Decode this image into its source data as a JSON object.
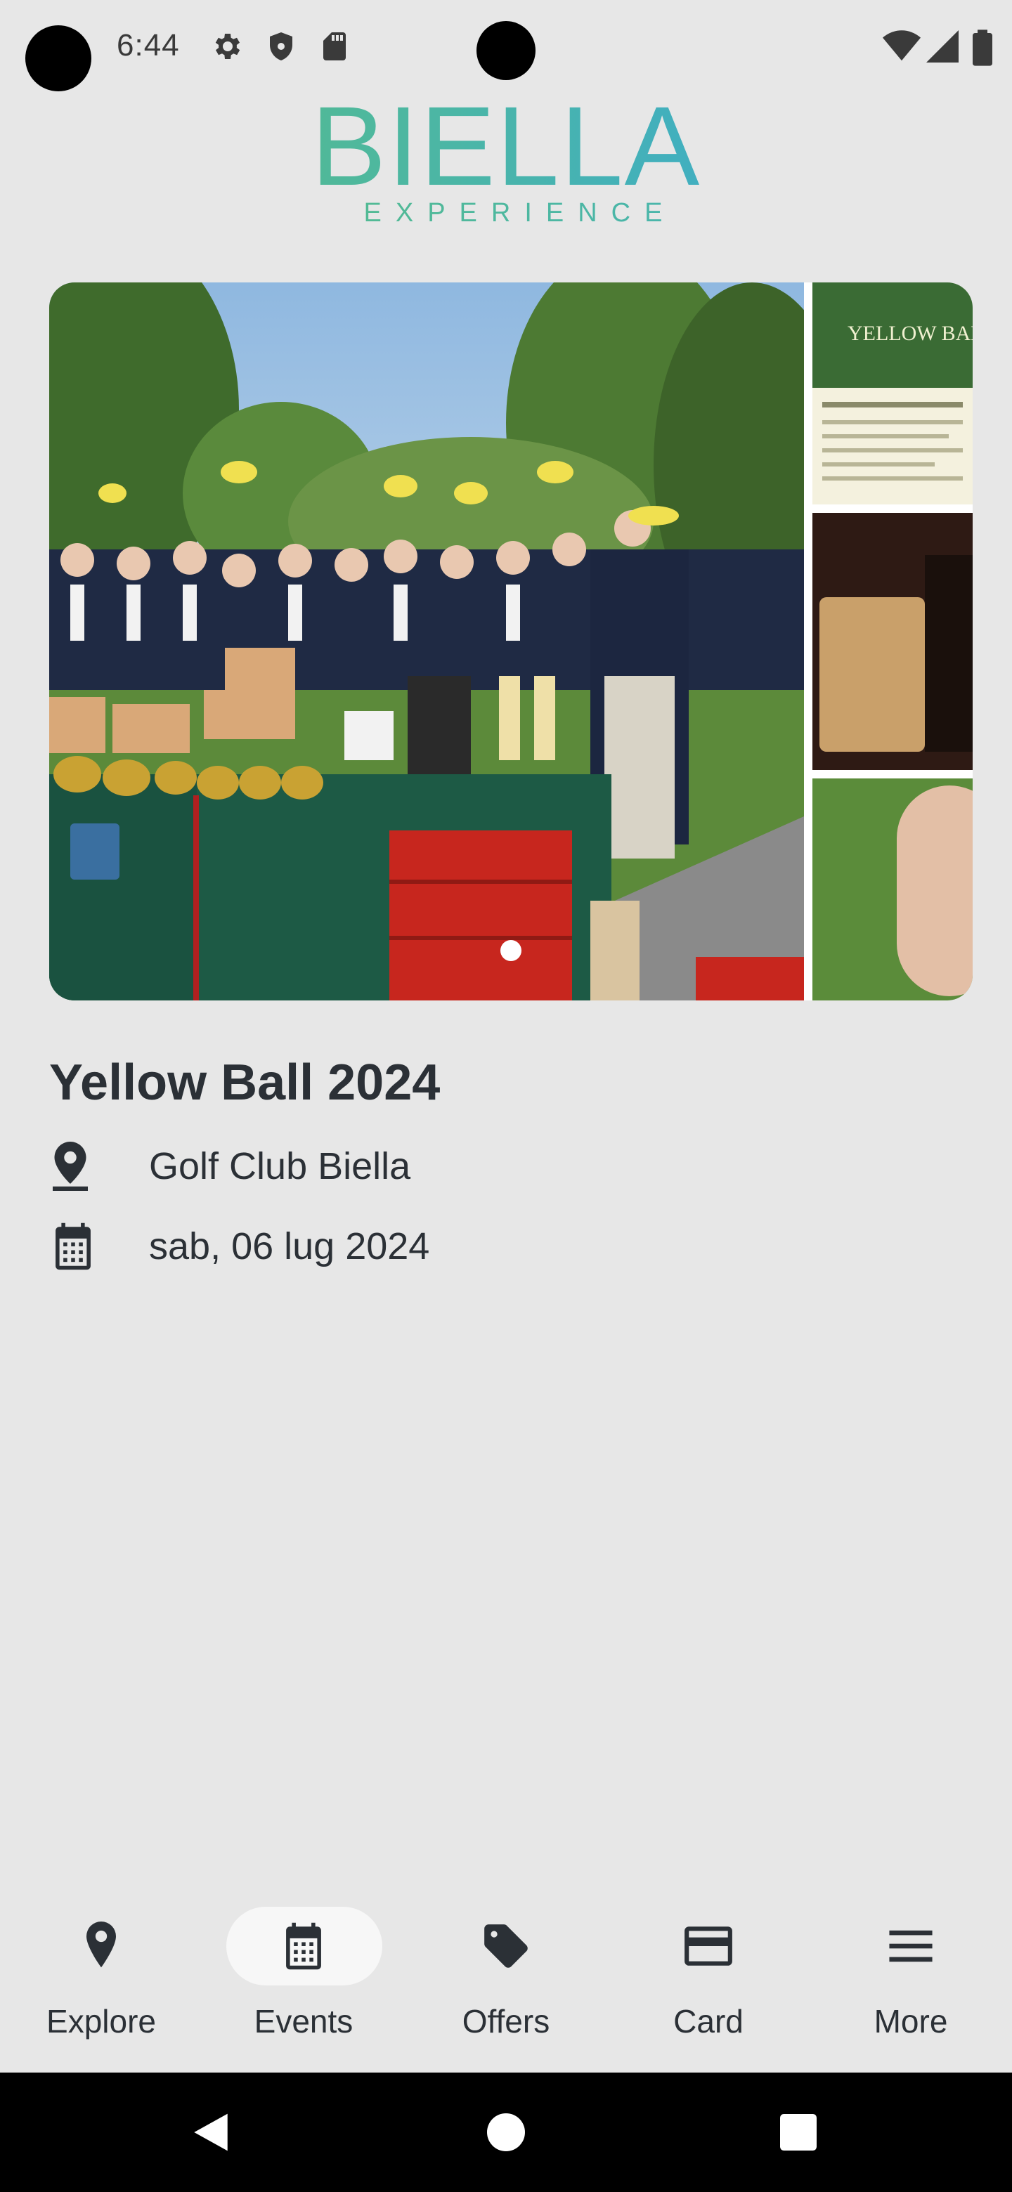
{
  "status_bar": {
    "time": "6:44",
    "icons_left": [
      "gear-icon",
      "shield-icon",
      "sd-card-icon"
    ],
    "icons_right": [
      "wifi-icon",
      "signal-icon",
      "battery-icon"
    ]
  },
  "header": {
    "logo_title": "BIELLA",
    "logo_subtitle": "EXPERIENCE"
  },
  "carousel": {
    "slide_count": 1,
    "active_slide": 1,
    "side_panels": [
      "YELLOW BALL",
      "",
      ""
    ]
  },
  "event": {
    "title": "Yellow Ball 2024",
    "location": "Golf Club Biella",
    "date": "sab, 06 lug 2024",
    "location_icon": "location-pin-icon",
    "date_icon": "calendar-icon"
  },
  "bottom_nav": {
    "items": [
      {
        "label": "Explore",
        "icon": "location-pin-icon",
        "active": false
      },
      {
        "label": "Events",
        "icon": "calendar-icon",
        "active": true
      },
      {
        "label": "Offers",
        "icon": "tag-icon",
        "active": false
      },
      {
        "label": "Card",
        "icon": "credit-card-icon",
        "active": false
      },
      {
        "label": "More",
        "icon": "menu-icon",
        "active": false
      }
    ]
  },
  "system_nav": [
    "back-icon",
    "home-icon",
    "recents-icon"
  ],
  "colors": {
    "background": "#e7e7e7",
    "text": "#2b3036",
    "logo_green": "#5cbf7a",
    "logo_blue": "#35a6e0",
    "active_pill": "#f7f7f7"
  }
}
